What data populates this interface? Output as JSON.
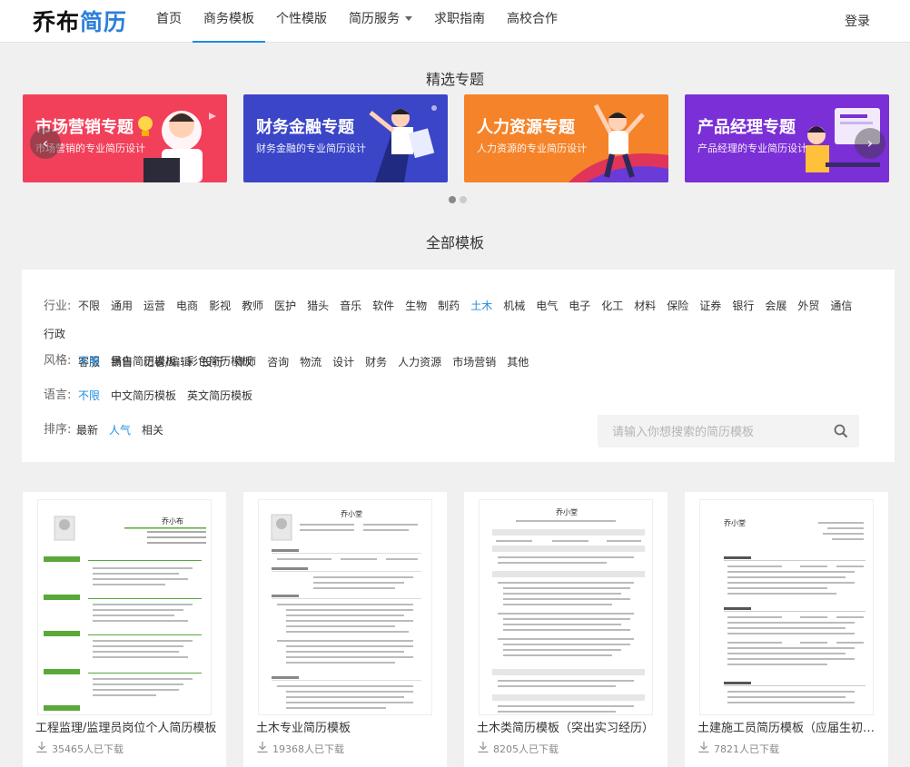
{
  "header": {
    "logo_black": "乔布",
    "logo_blue": "简历",
    "nav": [
      {
        "label": "首页"
      },
      {
        "label": "商务模板"
      },
      {
        "label": "个性模版"
      },
      {
        "label": "简历服务"
      },
      {
        "label": "求职指南"
      },
      {
        "label": "高校合作"
      }
    ],
    "login": "登录"
  },
  "featured": {
    "title": "精选专题",
    "banners": [
      {
        "title": "市场营销专题",
        "subtitle": "市场营销的专业简历设计",
        "color": "#f2405a"
      },
      {
        "title": "财务金融专题",
        "subtitle": "财务金融的专业简历设计",
        "color": "#3b45c8"
      },
      {
        "title": "人力资源专题",
        "subtitle": "人力资源的专业简历设计",
        "color": "#f5832a"
      },
      {
        "title": "产品经理专题",
        "subtitle": "产品经理的专业简历设计",
        "color": "#7b2fd6"
      }
    ]
  },
  "all_templates": {
    "title": "全部模板",
    "industry_label": "行业:",
    "industries": [
      "不限",
      "通用",
      "运营",
      "电商",
      "影视",
      "教师",
      "医护",
      "猎头",
      "音乐",
      "软件",
      "生物",
      "制药",
      "土木",
      "机械",
      "电气",
      "电子",
      "化工",
      "材料",
      "保险",
      "证券",
      "银行",
      "会展",
      "外贸",
      "通信",
      "行政",
      "客服",
      "销售",
      "记者/编辑",
      "投行",
      "律师",
      "咨询",
      "物流",
      "设计",
      "财务",
      "人力资源",
      "市场营销",
      "其他"
    ],
    "industry_selected": "土木",
    "style_label": "风格:",
    "styles": [
      "不限",
      "黑白简历模板",
      "彩色简历模板"
    ],
    "style_selected": "不限",
    "lang_label": "语言:",
    "langs": [
      "不限",
      "中文简历模板",
      "英文简历模板"
    ],
    "lang_selected": "不限",
    "sort_label": "排序:",
    "sorts": [
      "最新",
      "人气",
      "相关"
    ],
    "sort_selected": "人气",
    "search_placeholder": "请输入你想搜索的简历模板"
  },
  "cards": [
    {
      "title": "工程监理/监理员岗位个人简历模板",
      "downloads": "35465人已下载",
      "name": "乔小布"
    },
    {
      "title": "土木专业简历模板",
      "downloads": "19368人已下载",
      "name": "乔小堂"
    },
    {
      "title": "土木类简历模板（突出实习经历）",
      "downloads": "8205人已下载",
      "name": "乔小堂"
    },
    {
      "title": "土建施工员简历模板（应届生初级岗...",
      "downloads": "7821人已下载",
      "name": "乔小堂"
    }
  ],
  "colors": {
    "accent": "#1e8ce0",
    "green": "#5aa83a"
  }
}
